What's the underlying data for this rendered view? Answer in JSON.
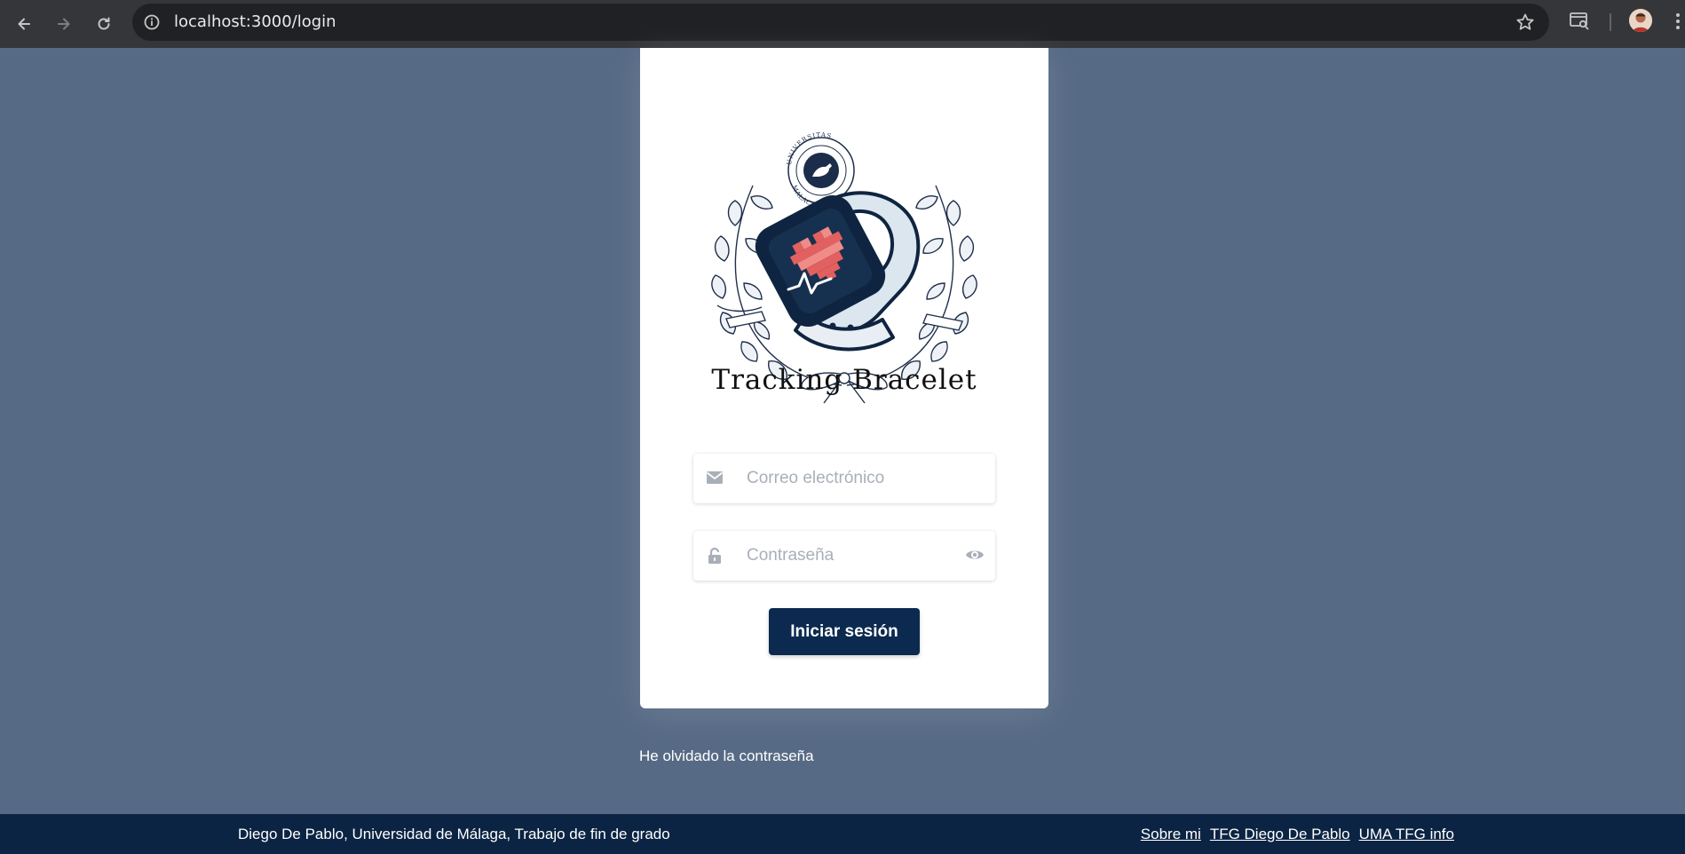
{
  "browser": {
    "url": "localhost:3000/login",
    "back_icon": "arrow-left-icon",
    "forward_icon": "arrow-right-icon",
    "reload_icon": "reload-icon",
    "info_icon": "info-circle-icon",
    "star_icon": "star-outline-icon",
    "tab_search_icon": "tab-search-icon",
    "menu_icon": "kebab-menu-icon"
  },
  "login": {
    "logo_icon": "tracking-bracelet-logo",
    "logo_seal_text": "UNIVERSITAS MALACITANA",
    "brand_title": "Tracking Bracelet",
    "email_placeholder": "Correo electrónico",
    "password_placeholder": "Contraseña",
    "submit_label": "Iniciar sesión",
    "forgot_password": "He olvidado la contraseña"
  },
  "footer": {
    "credit": "Diego De Pablo, Universidad de Málaga, Trabajo de fin de grado",
    "links": [
      "Sobre mi",
      "TFG Diego De Pablo",
      "UMA TFG info"
    ]
  },
  "colors": {
    "page_background": "#576a85",
    "primary_button": "#0c2a4f",
    "footer_background": "#0c2443",
    "card_background": "#ffffff"
  }
}
